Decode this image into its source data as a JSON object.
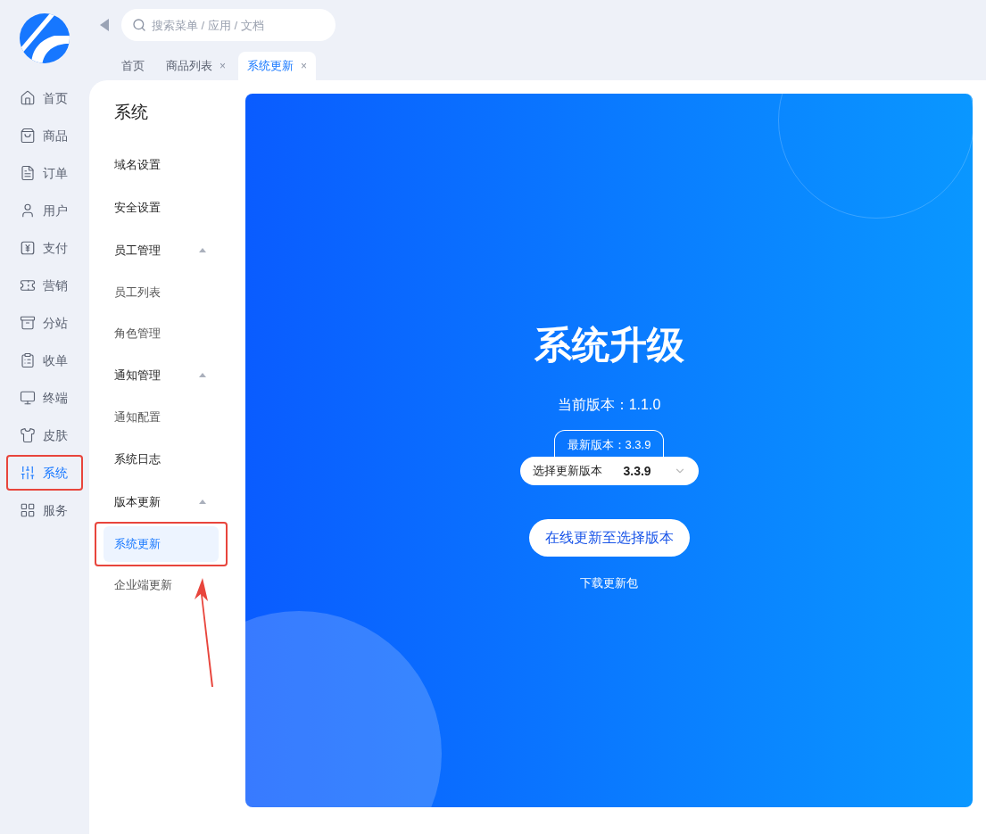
{
  "search": {
    "placeholder": "搜索菜单 / 应用 / 文档"
  },
  "tabs": [
    {
      "label": "首页",
      "selected": false
    },
    {
      "label": "商品列表",
      "selected": false,
      "close": "×"
    },
    {
      "label": "系统更新",
      "selected": true,
      "close": "×"
    }
  ],
  "sidebar": {
    "items": [
      {
        "label": "首页",
        "selected": false,
        "highlighted": false
      },
      {
        "label": "商品",
        "selected": false,
        "highlighted": false
      },
      {
        "label": "订单",
        "selected": false,
        "highlighted": false
      },
      {
        "label": "用户",
        "selected": false,
        "highlighted": false
      },
      {
        "label": "支付",
        "selected": false,
        "highlighted": false
      },
      {
        "label": "营销",
        "selected": false,
        "highlighted": false
      },
      {
        "label": "分站",
        "selected": false,
        "highlighted": false
      },
      {
        "label": "收单",
        "selected": false,
        "highlighted": false
      },
      {
        "label": "终端",
        "selected": false,
        "highlighted": false
      },
      {
        "label": "皮肤",
        "selected": false,
        "highlighted": false
      },
      {
        "label": "系统",
        "selected": true,
        "highlighted": true
      },
      {
        "label": "服务",
        "selected": false,
        "highlighted": false
      }
    ]
  },
  "submenu": {
    "title": "系统",
    "items": [
      {
        "label": "域名设置"
      },
      {
        "label": "安全设置"
      },
      {
        "label": "员工管理",
        "expanded": true,
        "children": [
          {
            "label": "员工列表",
            "selected": false,
            "highlighted": false
          },
          {
            "label": "角色管理",
            "selected": false,
            "highlighted": false
          }
        ]
      },
      {
        "label": "通知管理",
        "expanded": true,
        "children": [
          {
            "label": "通知配置",
            "selected": false,
            "highlighted": false
          }
        ]
      },
      {
        "label": "系统日志"
      },
      {
        "label": "版本更新",
        "expanded": true,
        "children": [
          {
            "label": "系统更新",
            "selected": true,
            "highlighted": true
          },
          {
            "label": "企业端更新",
            "selected": false,
            "highlighted": false
          }
        ]
      }
    ]
  },
  "upgrade": {
    "title": "系统升级",
    "current": "当前版本：1.1.0",
    "latest": "最新版本：3.3.9",
    "select_label": "选择更新版本",
    "select_value": "3.3.9",
    "update_button": "在线更新至选择版本",
    "download_link": "下载更新包"
  }
}
